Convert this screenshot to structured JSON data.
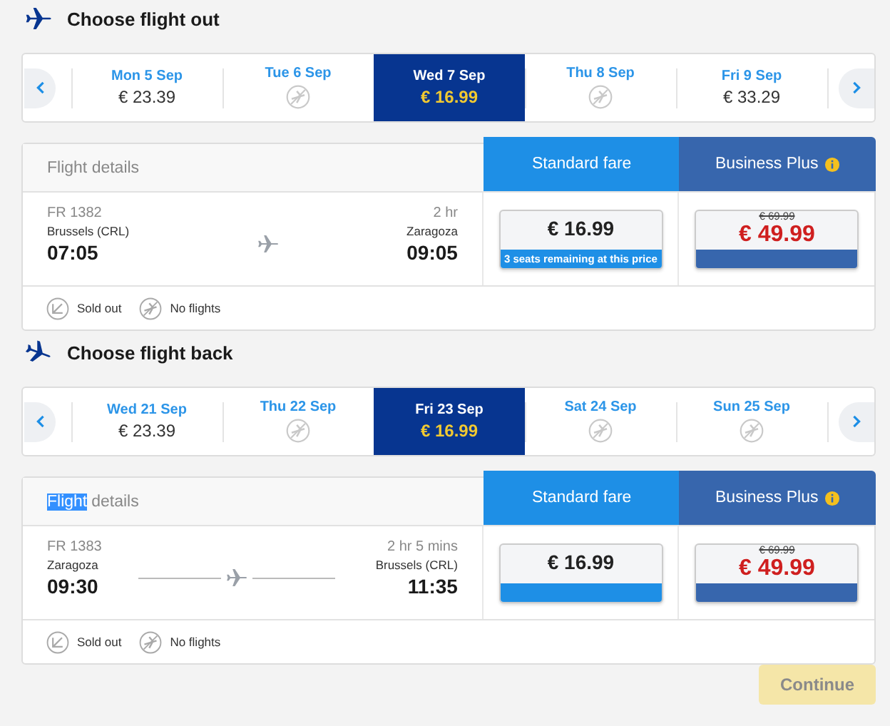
{
  "sections": [
    {
      "title": "Choose flight out",
      "dates": [
        {
          "day": "Mon 5 Sep",
          "price": "€ 23.39",
          "selected": false
        },
        {
          "day": "Tue 6 Sep",
          "selected": false
        },
        {
          "day": "Wed 7 Sep",
          "price": "€ 16.99",
          "selected": true
        },
        {
          "day": "Thu 8 Sep",
          "selected": false
        },
        {
          "day": "Fri 9 Sep",
          "price": "€ 33.29",
          "selected": false
        }
      ],
      "details_title": [
        {
          "text": "Flight details",
          "selected": false
        }
      ],
      "fares": [
        {
          "kind": "standard",
          "label": "Standard fare",
          "price": "€ 16.99",
          "note": "3 seats remaining at this price"
        },
        {
          "kind": "business",
          "label": "Business Plus",
          "old_price": "€ 69.99",
          "price": "€ 49.99"
        }
      ],
      "flight": {
        "number": "FR 1382",
        "duration": "2 hr",
        "from": "Brussels (CRL)",
        "to": "Zaragoza",
        "depart": "07:05",
        "arrive": "09:05",
        "route_line": false
      },
      "legend": [
        {
          "kind": "sold_out",
          "label": "Sold out"
        },
        {
          "kind": "no_flights",
          "label": "No flights"
        }
      ]
    },
    {
      "title": "Choose flight back",
      "dates": [
        {
          "day": "Wed 21 Sep",
          "price": "€ 23.39",
          "selected": false
        },
        {
          "day": "Thu 22 Sep",
          "selected": false
        },
        {
          "day": "Fri 23 Sep",
          "price": "€ 16.99",
          "selected": true
        },
        {
          "day": "Sat 24 Sep",
          "selected": false
        },
        {
          "day": "Sun 25 Sep",
          "selected": false
        }
      ],
      "details_title": [
        {
          "text": "Flight",
          "selected": true
        },
        {
          "text": "details",
          "selected": false
        }
      ],
      "fares": [
        {
          "kind": "standard",
          "label": "Standard fare",
          "price": "€ 16.99"
        },
        {
          "kind": "business",
          "label": "Business Plus",
          "old_price": "€ 69.99",
          "price": "€ 49.99"
        }
      ],
      "flight": {
        "number": "FR 1383",
        "duration": "2 hr 5 mins",
        "from": "Zaragoza",
        "to": "Brussels (CRL)",
        "depart": "09:30",
        "arrive": "11:35",
        "route_line": true
      },
      "legend": [
        {
          "kind": "sold_out",
          "label": "Sold out"
        },
        {
          "kind": "no_flights",
          "label": "No flights"
        }
      ]
    }
  ],
  "continue_button": {
    "label": "Continue",
    "disabled": true
  }
}
